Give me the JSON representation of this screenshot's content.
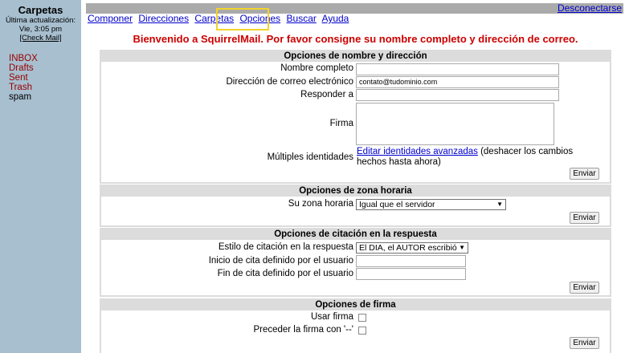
{
  "sidebar": {
    "title": "Carpetas",
    "last_update_label": "Última actualización:",
    "last_update_time": "Vie, 3:05 pm",
    "check_mail": "[Check Mail]",
    "folders": [
      "INBOX",
      "Drafts",
      "Sent",
      "Trash",
      "spam"
    ]
  },
  "topbar": {
    "logout": "Desconectarse"
  },
  "menu": [
    "Componer",
    "Direcciones",
    "Carpetas",
    "Opciones",
    "Buscar",
    "Ayuda"
  ],
  "welcome": "Bienvenido a SquirrelMail. Por favor consigne su nombre completo y dirección de correo.",
  "sections": {
    "identity": {
      "title": "Opciones de nombre y dirección",
      "full_name_label": "Nombre completo",
      "full_name_value": "",
      "email_label": "Dirección de correo electrónico",
      "email_value": "contato@tudominio.com",
      "reply_to_label": "Responder a",
      "reply_to_value": "",
      "signature_label": "Firma",
      "multiple_label": "Múltiples identidades",
      "multiple_link": "Editar identidades avanzadas",
      "multiple_note": " (deshacer los cambios hechos hasta ahora)",
      "submit": "Enviar"
    },
    "timezone": {
      "title": "Opciones de zona horaria",
      "tz_label": "Su zona horaria",
      "tz_value": "Igual que el servidor",
      "submit": "Enviar"
    },
    "reply": {
      "title": "Opciones de citación en la respuesta",
      "style_label": "Estilo de citación en la respuesta",
      "style_value": "El DIA, el AUTOR escribió",
      "start_label": "Inicio de cita definido por el usuario",
      "end_label": "Fin de cita definido por el usuario",
      "submit": "Enviar"
    },
    "signature": {
      "title": "Opciones de firma",
      "use_label": "Usar firma",
      "prefix_label": "Preceder la firma con '--'",
      "submit": "Enviar"
    }
  }
}
